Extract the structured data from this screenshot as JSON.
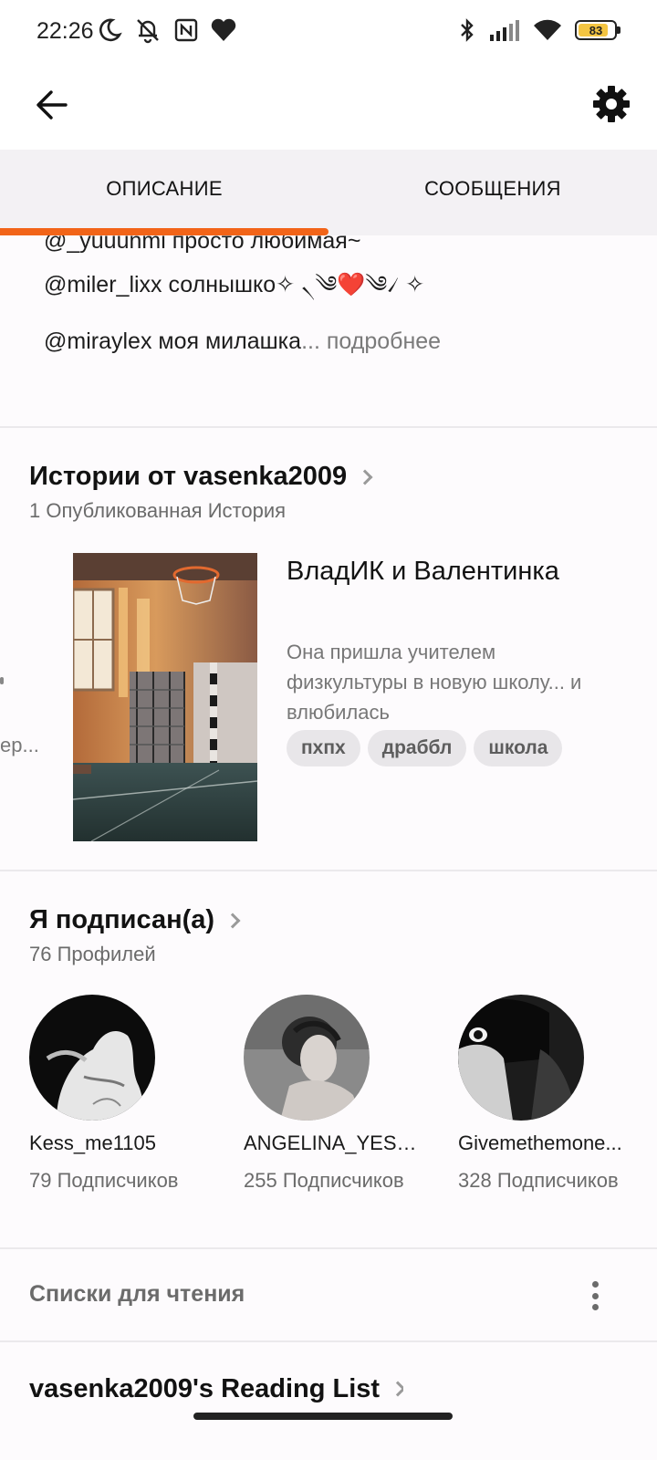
{
  "status_bar": {
    "time": "22:26",
    "battery": "83",
    "battery_level": 0.83,
    "icons": [
      "moon-icon",
      "muted-bell-icon",
      "nfc-icon",
      "heart-icon",
      "bluetooth-icon",
      "signal-icon",
      "wifi-icon",
      "battery-icon"
    ]
  },
  "appbar": {
    "back_icon": "arrow-left-icon",
    "settings_icon": "gear-icon"
  },
  "tabs": [
    {
      "label": "ОПИСАНИЕ",
      "active": true
    },
    {
      "label": "СООБЩЕНИЯ",
      "active": false
    }
  ],
  "accent_color": "#f26418",
  "description": {
    "line_partial": "@_yuuunmi просто любимая~",
    "line2": "@miler_lixx солнышко✧ ৲༄❤️༄৴ ✧",
    "line3": "@miraylex моя милашка",
    "ellipsis": "...",
    "more": " подробнее"
  },
  "stories": {
    "title": "Истории от vasenka2009",
    "subtitle": "1 Опубликованная История",
    "peek_text": "ер...",
    "item": {
      "title": "ВладИК и Валентинка",
      "description": "Она пришла учителем физкультуры в новую школу... и влюбилась",
      "tags": [
        "пхпх",
        "драббл",
        "школа"
      ]
    }
  },
  "following": {
    "title": "Я подписан(а)",
    "subtitle": "76 Профилей",
    "profiles": [
      {
        "name": "Kess_me1105",
        "followers": "79 Подписчиков"
      },
      {
        "name": "ANGELINA_YESS...",
        "followers": "255 Подписчиков"
      },
      {
        "name": "Givemethemone...",
        "followers": "328 Подписчиков"
      }
    ]
  },
  "reading_lists": {
    "label": "Списки для чтения",
    "list_title": "vasenka2009's Reading List"
  }
}
